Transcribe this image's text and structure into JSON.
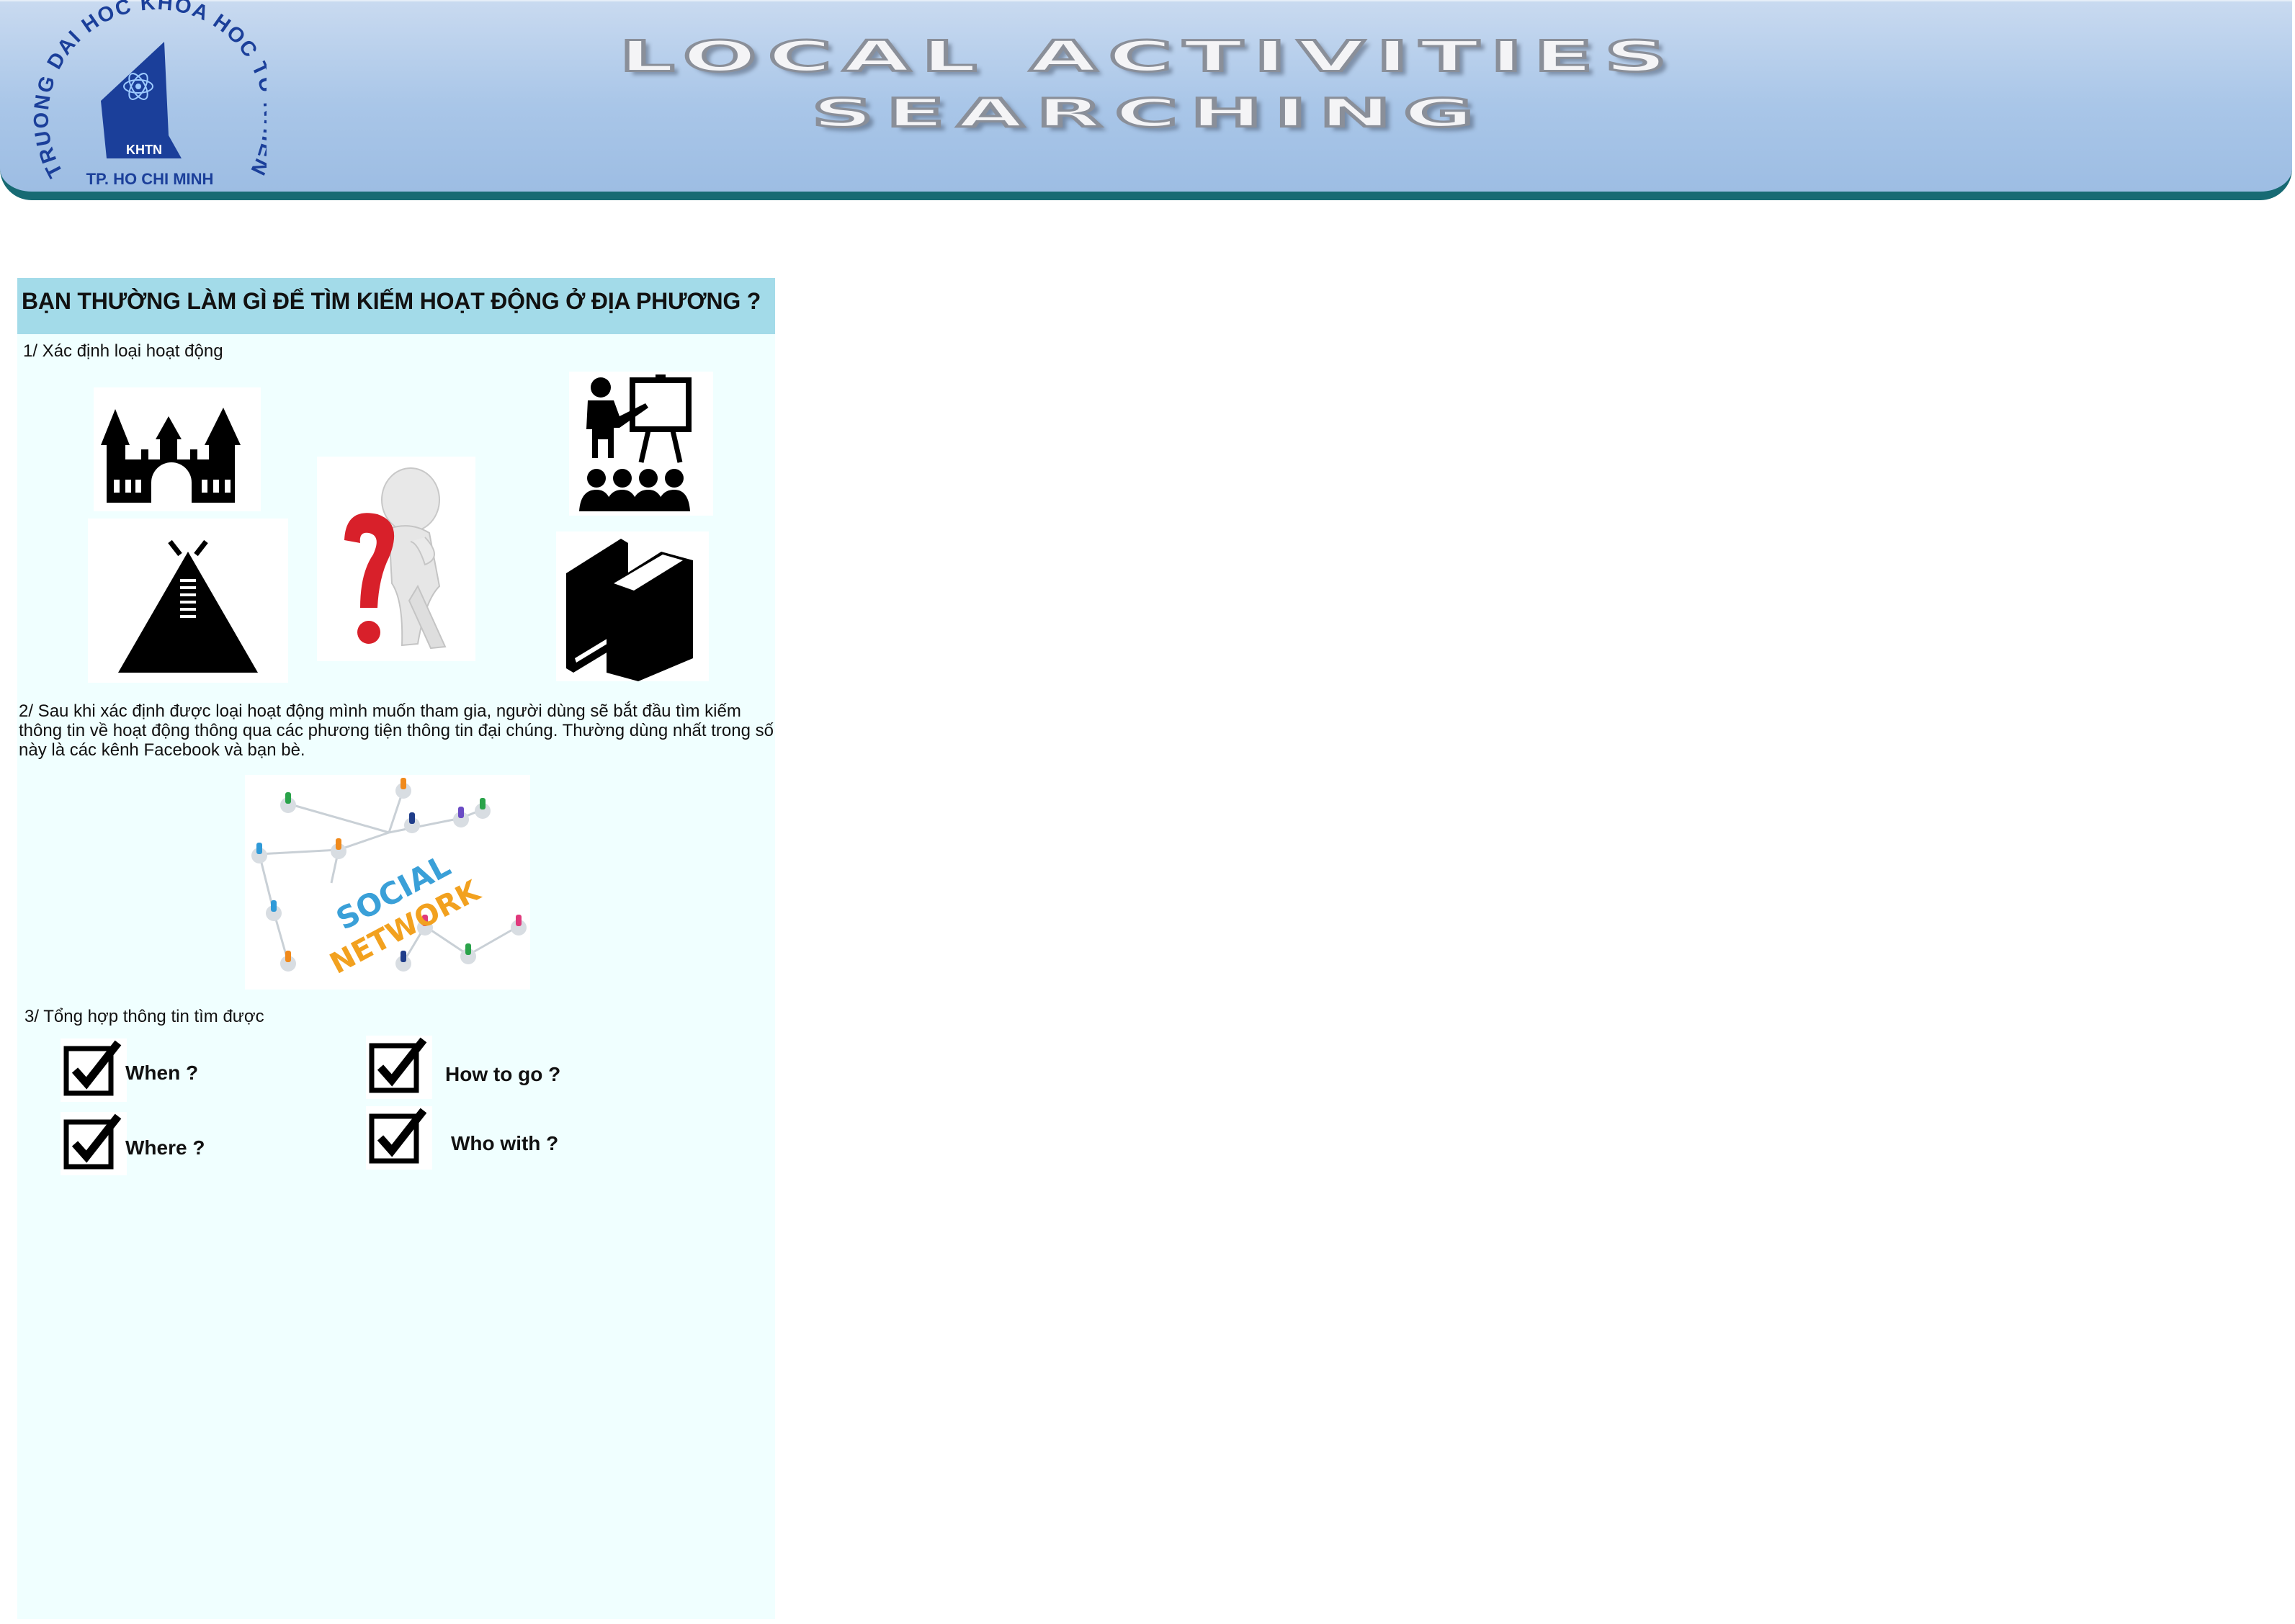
{
  "header": {
    "logo": {
      "ring_text": "TRUONG DAI HOC KHOA HOC TU NHIEN",
      "city_text": "TP. HO CHI MINH",
      "abbr": "KHTN"
    },
    "title_line1": "LOCAL ACTIVITIES",
    "title_line2": "SEARCHING"
  },
  "panel": {
    "heading": "BẠN THƯỜNG LÀM GÌ ĐỂ TÌM KIẾM HOẠT ĐỘNG Ở ĐỊA PHƯƠNG ?",
    "step1": "1/ Xác định loại hoạt động",
    "step2": "2/ Sau khi xác định được loại hoạt động mình muốn tham gia, người dùng sẽ bắt đầu tìm kiếm thông tin về hoạt động thông qua các phương tiện thông tin đại chúng. Thường dùng nhất trong số này là các kênh Facebook và bạn bè.",
    "step3": "3/ Tổng hợp thông tin tìm được",
    "social_word1": "SOCIAL",
    "social_word2": "NETWORK",
    "checklist": [
      {
        "label": "When ?"
      },
      {
        "label": "How to go ?"
      },
      {
        "label": "Where ?"
      },
      {
        "label": "Who with ?"
      }
    ]
  },
  "colors": {
    "banner": "#a9c6e8",
    "banner_border": "#176a73",
    "panel_bg": "#f0ffff",
    "panel_header": "#a3dbe9"
  }
}
